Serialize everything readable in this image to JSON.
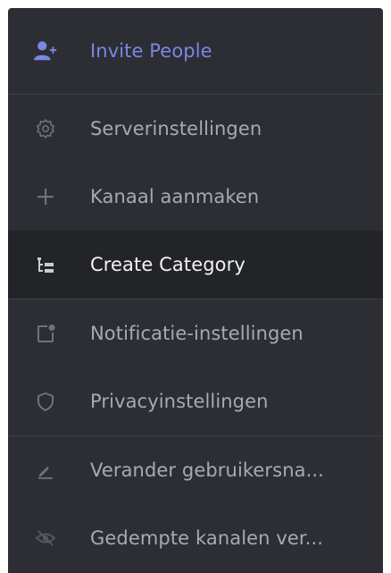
{
  "menu": {
    "items": [
      {
        "label": "Invite People",
        "icon": "add-user-icon"
      },
      {
        "label": "Serverinstellingen",
        "icon": "gear-icon"
      },
      {
        "label": "Kanaal aanmaken",
        "icon": "plus-icon"
      },
      {
        "label": "Create Category",
        "icon": "category-icon"
      },
      {
        "label": "Notificatie-instellingen",
        "icon": "notification-icon"
      },
      {
        "label": "Privacyinstellingen",
        "icon": "shield-icon"
      },
      {
        "label": "Verander gebruikersna...",
        "icon": "pencil-icon"
      },
      {
        "label": "Gedempte kanalen ver...",
        "icon": "eye-slash-icon"
      }
    ]
  },
  "colors": {
    "background": "#2c2e33",
    "active_background": "#232428",
    "accent": "#7a87e4",
    "text": "#a7aab0",
    "active_text": "#f1f2f4",
    "divider": "#3d4047"
  }
}
